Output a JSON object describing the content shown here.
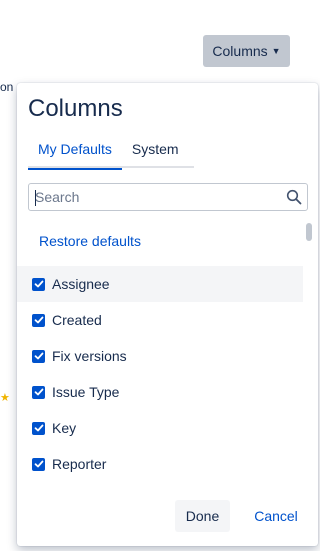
{
  "background": {
    "columns_button_label": "Columns",
    "edge_text": "on"
  },
  "dialog": {
    "title": "Columns",
    "tabs": [
      {
        "label": "My Defaults",
        "active": true
      },
      {
        "label": "System",
        "active": false
      }
    ],
    "search": {
      "placeholder": "Search",
      "value": ""
    },
    "restore_label": "Restore defaults",
    "options": [
      {
        "label": "Assignee",
        "checked": true
      },
      {
        "label": "Created",
        "checked": true
      },
      {
        "label": "Fix versions",
        "checked": true
      },
      {
        "label": "Issue Type",
        "checked": true
      },
      {
        "label": "Key",
        "checked": true
      },
      {
        "label": "Reporter",
        "checked": true
      }
    ],
    "done_label": "Done",
    "cancel_label": "Cancel"
  },
  "colors": {
    "accent": "#0052cc",
    "text": "#172b4d",
    "hover_row": "#f4f5f7",
    "star": "#f0b400"
  },
  "icons": {
    "search": "search-icon",
    "check": "check-icon",
    "chevron": "chevron-down-icon",
    "star": "star-icon"
  }
}
